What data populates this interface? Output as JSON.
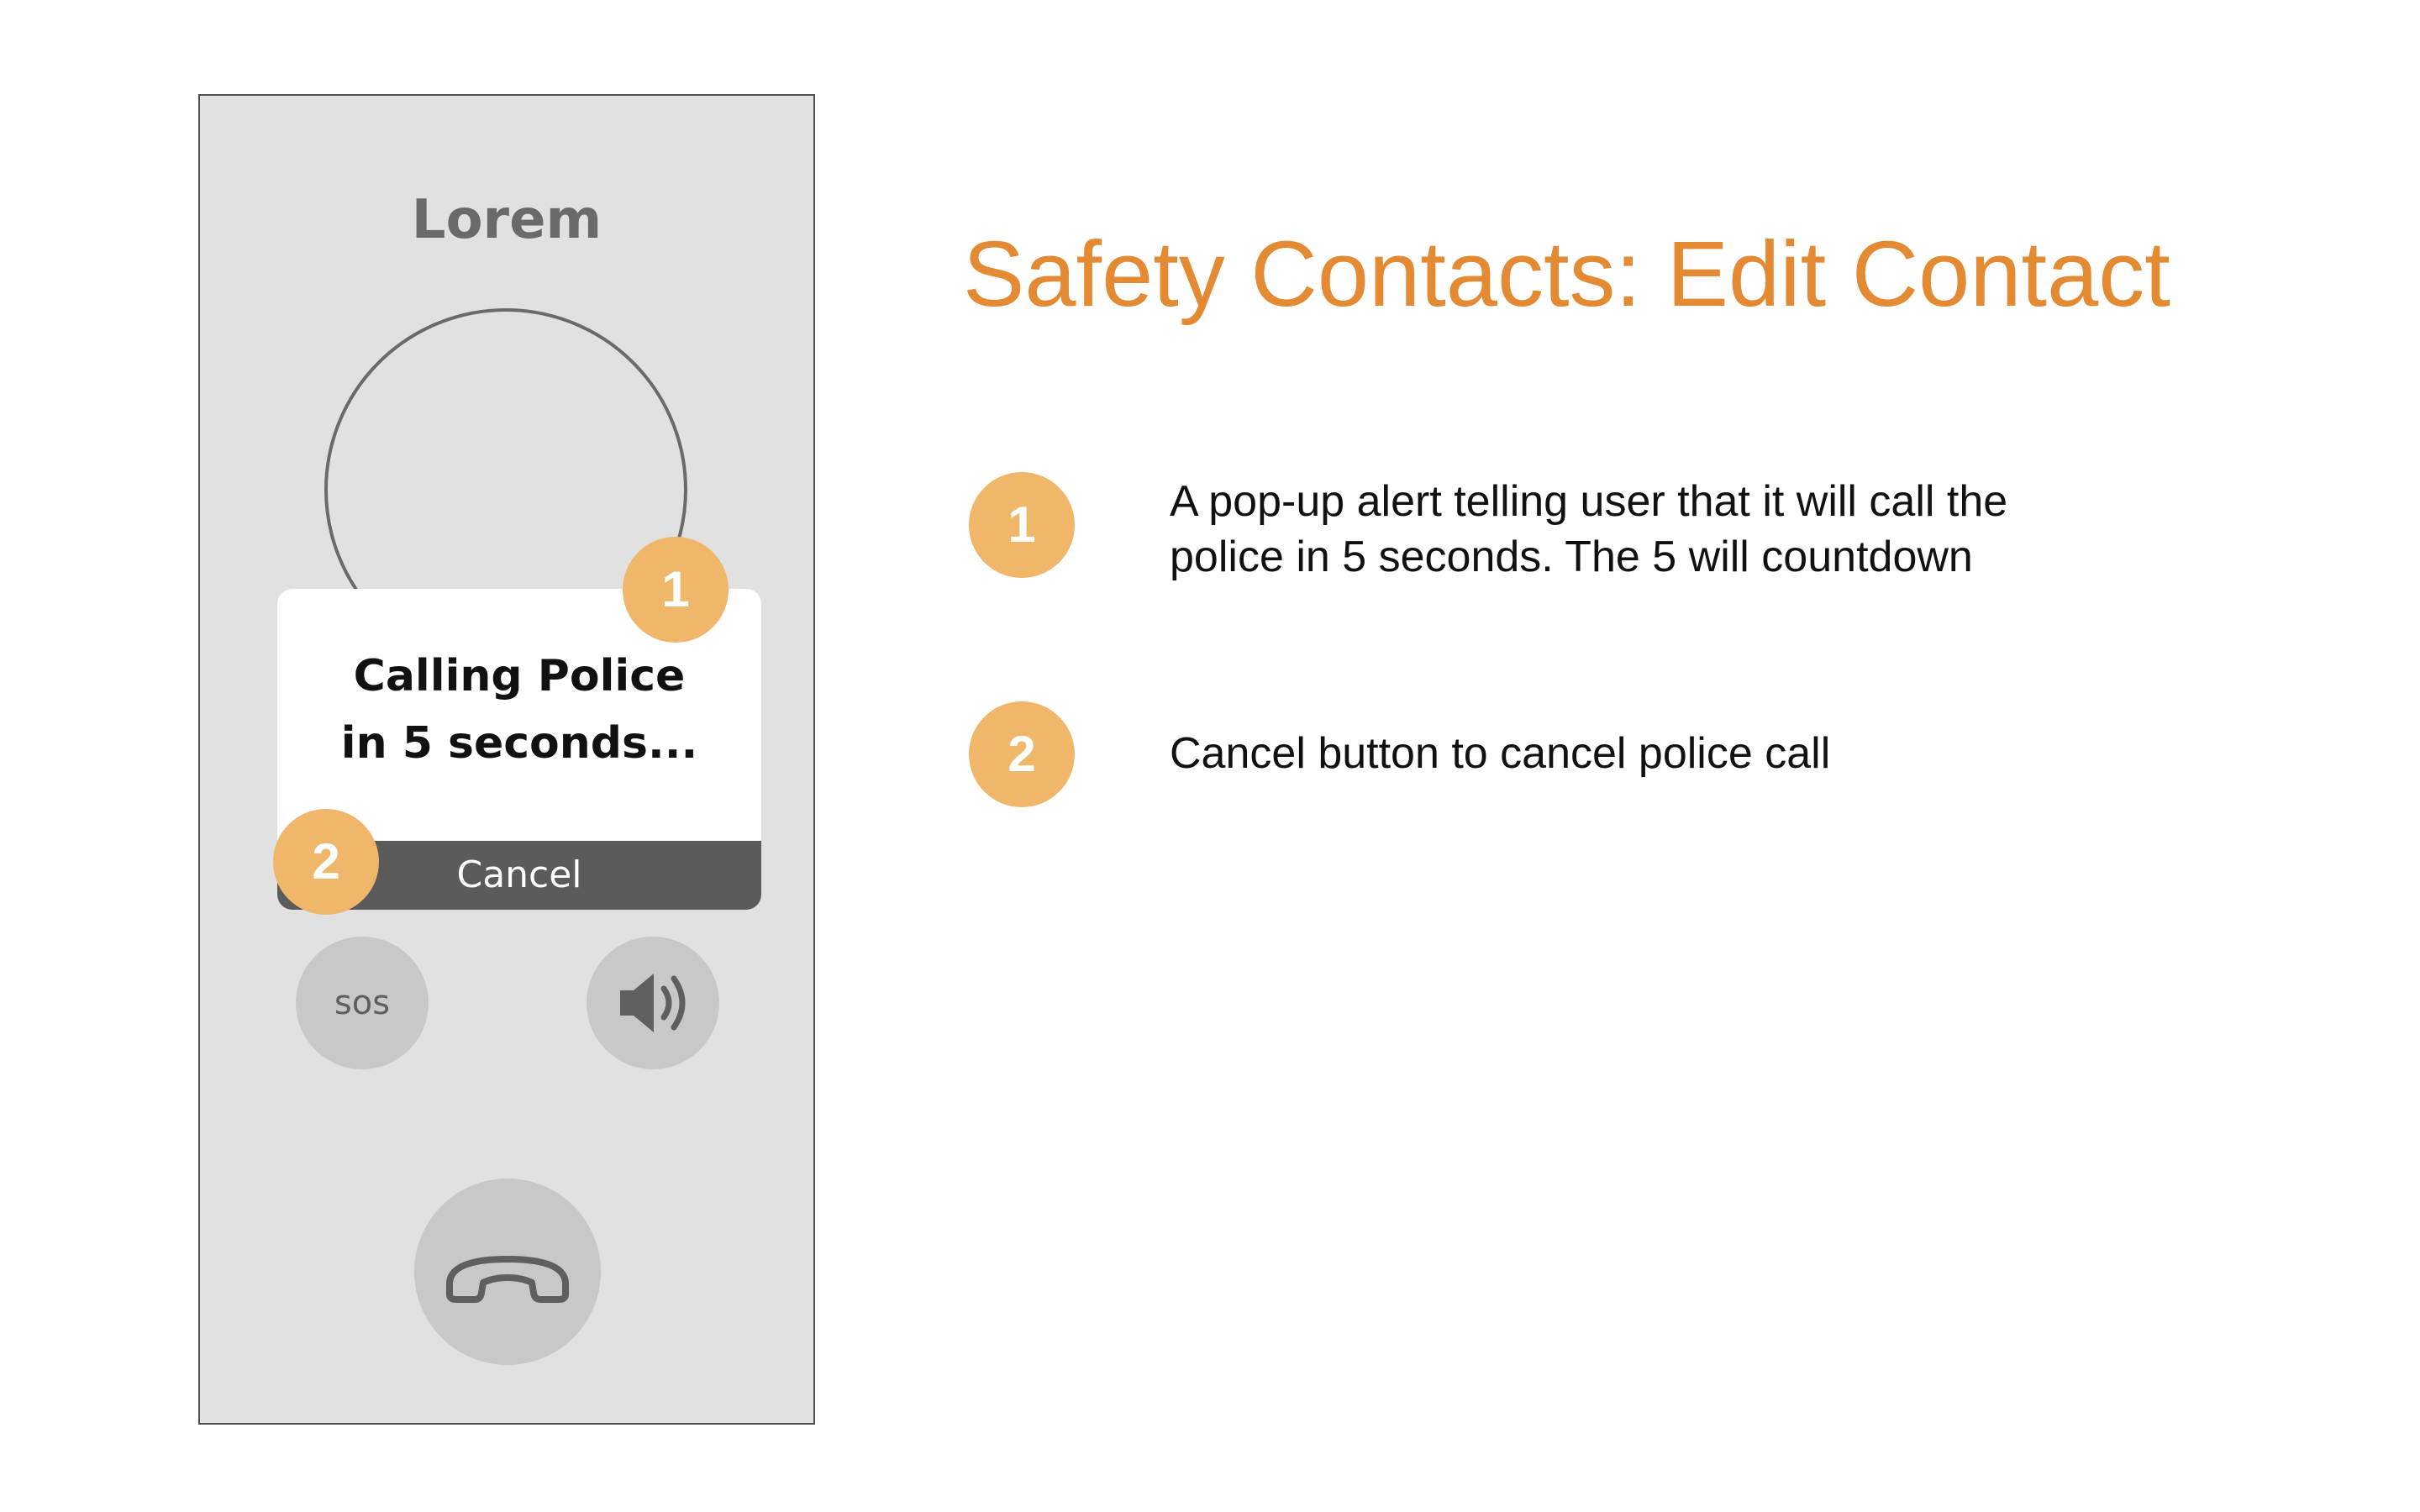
{
  "colors": {
    "accent": "#e48a33",
    "marker": "#f0b66a",
    "phone_bg": "#e1e1e1",
    "button_bg": "#c8c8c8",
    "cancel_bar": "#5b5b5b"
  },
  "phone": {
    "title": "Lorem",
    "popup": {
      "line1": "Calling Police",
      "line2": "in 5 seconds...",
      "cancel_label": "Cancel"
    },
    "buttons": {
      "sos_label": "SOS",
      "speaker_icon": "speaker-icon",
      "end_call_icon": "end-call-icon"
    }
  },
  "markers": [
    "1",
    "2"
  ],
  "heading": "Safety Contacts: Edit Contact",
  "notes": [
    {
      "number": "1",
      "line1": "A pop-up alert telling user that it will call the",
      "line2": "police in 5 seconds. The 5 will countdown"
    },
    {
      "number": "2",
      "line1": "Cancel button to cancel police call"
    }
  ]
}
